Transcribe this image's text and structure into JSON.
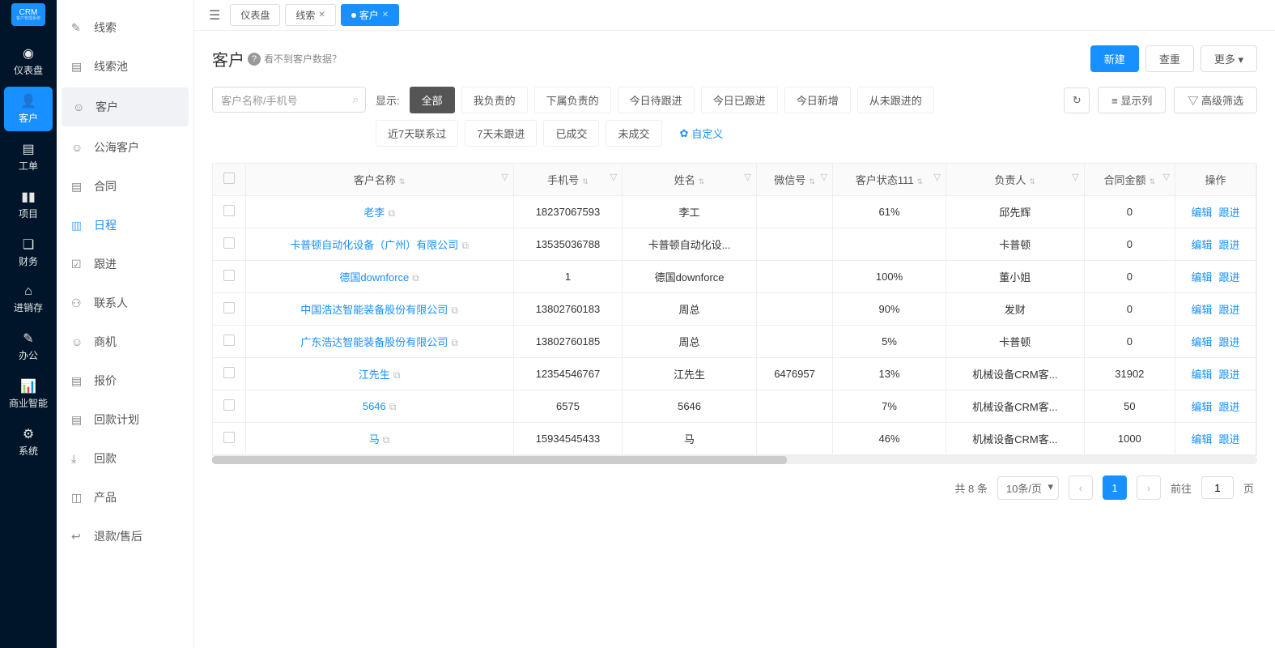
{
  "brand": {
    "title": "CRM",
    "sub": "客户管理系统"
  },
  "leftnav": [
    {
      "icon": "◉",
      "label": "仪表盘"
    },
    {
      "icon": "👤",
      "label": "客户",
      "active": true
    },
    {
      "icon": "▤",
      "label": "工单"
    },
    {
      "icon": "▮▮",
      "label": "项目"
    },
    {
      "icon": "❏",
      "label": "财务"
    },
    {
      "icon": "⌂",
      "label": "进销存"
    },
    {
      "icon": "✎",
      "label": "办公"
    },
    {
      "icon": "📊",
      "label": "商业智能"
    },
    {
      "icon": "⚙",
      "label": "系统"
    }
  ],
  "sidebar": [
    {
      "icon": "✎",
      "label": "线索"
    },
    {
      "icon": "▤",
      "label": "线索池"
    },
    {
      "icon": "☺",
      "label": "客户",
      "active": true
    },
    {
      "icon": "☺",
      "label": "公海客户"
    },
    {
      "icon": "▤",
      "label": "合同"
    },
    {
      "icon": "▥",
      "label": "日程",
      "blue": true
    },
    {
      "icon": "☑",
      "label": "跟进"
    },
    {
      "icon": "⚇",
      "label": "联系人"
    },
    {
      "icon": "☺",
      "label": "商机"
    },
    {
      "icon": "▤",
      "label": "报价"
    },
    {
      "icon": "▤",
      "label": "回款计划"
    },
    {
      "icon": "⤓",
      "label": "回款"
    },
    {
      "icon": "◫",
      "label": "产品"
    },
    {
      "icon": "↩",
      "label": "退款/售后"
    }
  ],
  "tabs": [
    {
      "label": "仪表盘"
    },
    {
      "label": "线索",
      "closable": true
    },
    {
      "label": "客户",
      "closable": true,
      "active": true
    }
  ],
  "page": {
    "title": "客户",
    "hint": "看不到客户数据？"
  },
  "header_actions": {
    "create": "新建",
    "reset": "查重",
    "more": "更多"
  },
  "search": {
    "placeholder": "客户名称/手机号"
  },
  "filters": {
    "label": "显示:",
    "chips": [
      "全部",
      "我负责的",
      "下属负责的",
      "今日待跟进",
      "今日已跟进",
      "今日新增",
      "从未跟进的",
      "近7天联系过",
      "7天未跟进",
      "已成交",
      "未成交"
    ],
    "active": "全部",
    "custom": "自定义"
  },
  "toolbar_right": {
    "refresh": "↻",
    "cols": "显示列",
    "adv": "高级筛选"
  },
  "table": {
    "columns": [
      "",
      "客户名称",
      "手机号",
      "姓名",
      "微信号",
      "客户状态111",
      "负责人",
      "合同金额",
      "操作"
    ],
    "actions": {
      "edit": "编辑",
      "follow": "跟进"
    },
    "rows": [
      {
        "name": "老李",
        "phone": "18237067593",
        "contact": "李工",
        "wechat": "",
        "status": "61%",
        "owner": "邱先辉",
        "amount": "0"
      },
      {
        "name": "卡普顿自动化设备（广州）有限公司",
        "phone": "13535036788",
        "contact": "卡普顿自动化设...",
        "wechat": "",
        "status": "",
        "owner": "卡普顿",
        "amount": "0"
      },
      {
        "name": "德国downforce",
        "phone": "1",
        "contact": "德国downforce",
        "wechat": "",
        "status": "100%",
        "owner": "董小姐",
        "amount": "0"
      },
      {
        "name": "中国浩达智能装备股份有限公司",
        "phone": "13802760183",
        "contact": "周总",
        "wechat": "",
        "status": "90%",
        "owner": "发财",
        "amount": "0"
      },
      {
        "name": "广东浩达智能装备股份有限公司",
        "phone": "13802760185",
        "contact": "周总",
        "wechat": "",
        "status": "5%",
        "owner": "卡普顿",
        "amount": "0"
      },
      {
        "name": "江先生",
        "phone": "12354546767",
        "contact": "江先生",
        "wechat": "6476957",
        "status": "13%",
        "owner": "机械设备CRM客...",
        "amount": "31902"
      },
      {
        "name": "5646",
        "phone": "6575",
        "contact": "5646",
        "wechat": "",
        "status": "7%",
        "owner": "机械设备CRM客...",
        "amount": "50"
      },
      {
        "name": "马",
        "phone": "15934545433",
        "contact": "马",
        "wechat": "",
        "status": "46%",
        "owner": "机械设备CRM客...",
        "amount": "1000"
      }
    ]
  },
  "pager": {
    "total": "共 8 条",
    "size": "10条/页",
    "current": "1",
    "goto": "前往",
    "goto_val": "1",
    "unit": "页"
  }
}
